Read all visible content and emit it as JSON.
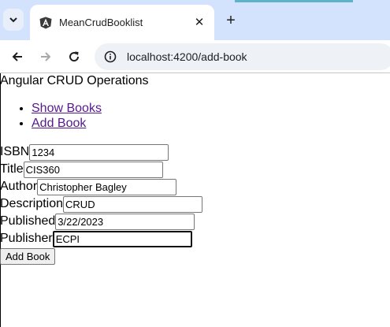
{
  "browser": {
    "tab_title": "MeanCrudBooklist",
    "tab_close": "✕",
    "new_tab": "+",
    "url": "localhost:4200/add-book",
    "icons": {
      "tab_search": "chevron-down-icon",
      "favicon": "angular-icon",
      "back": "arrow-left-icon",
      "forward": "arrow-right-icon",
      "reload": "reload-icon",
      "site_info": "info-icon"
    },
    "colors": {
      "tabstrip": "#d3e3fd",
      "omnibox": "#eef1f6"
    }
  },
  "page": {
    "heading": "Angular CRUD Operations",
    "nav": [
      {
        "label": "Show Books"
      },
      {
        "label": "Add Book"
      }
    ],
    "form": {
      "fields": [
        {
          "label": "ISBN",
          "value": "1234"
        },
        {
          "label": "Title",
          "value": "CIS360"
        },
        {
          "label": "Author",
          "value": "Christopher Bagley"
        },
        {
          "label": "Description",
          "value": "CRUD"
        },
        {
          "label": "Published",
          "value": "3/22/2023"
        },
        {
          "label": "Publisher",
          "value": "ECPI"
        }
      ],
      "submit_label": "Add Book"
    },
    "colors": {
      "link": "#551a8b"
    }
  }
}
